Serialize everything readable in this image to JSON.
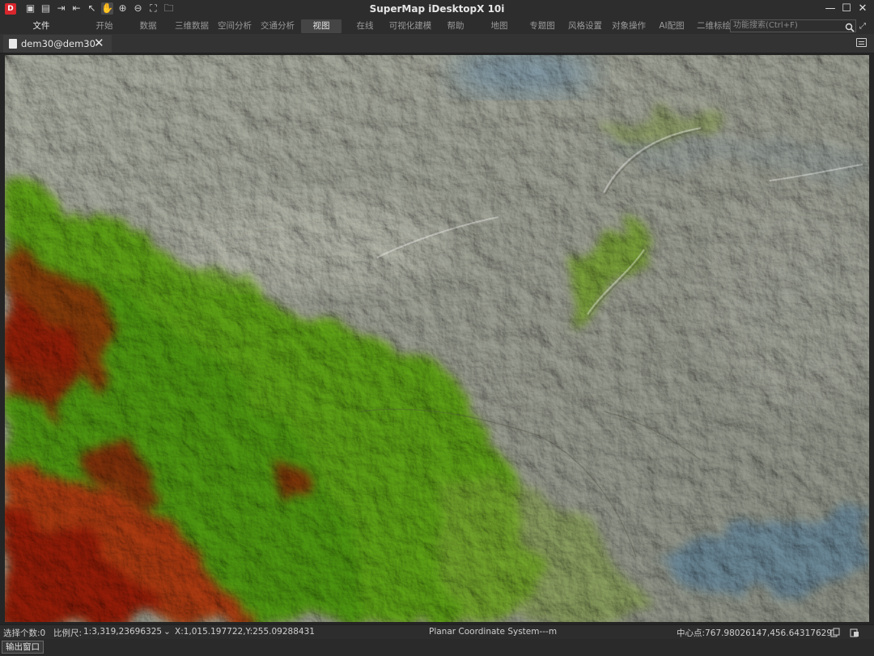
{
  "window": {
    "title": "SuperMap iDesktopX 10i",
    "minimize": "—",
    "maximize": "☐",
    "close": "✕"
  },
  "quick_access": {
    "logo": "D",
    "icons": [
      "save-icon",
      "save-as-icon",
      "import-icon",
      "export-icon",
      "select-pointer-icon",
      "pan-hand-icon",
      "zoom-in-icon",
      "zoom-out-icon",
      "full-extent-icon",
      "open-folder-icon"
    ]
  },
  "ribbon": {
    "tabs": [
      "文件",
      "开始",
      "数据",
      "三维数据",
      "空间分析",
      "交通分析",
      "视图",
      "在线",
      "可视化建模",
      "帮助",
      "地图",
      "专题图",
      "风格设置",
      "对象操作",
      "AI配图",
      "二维标绘"
    ],
    "active_tab": "视图",
    "search_placeholder": "功能搜索(Ctrl+F)"
  },
  "document_tab": {
    "label": "dem30@dem30",
    "close": "✕"
  },
  "map": {
    "dataset": "dem30",
    "type": "DEM hillshade"
  },
  "status": {
    "selection_count": "选择个数:0",
    "scale_label": "比例尺:",
    "scale_value": "1:3,319,23696325",
    "cursor_coords": "X:1,015.197722,Y:255.09288431",
    "coordinate_system": "Planar Coordinate System---m",
    "center_point": "中心点:767.98026147,456.64317629"
  },
  "bottom": {
    "output_tab": "输出窗口"
  },
  "colors": {
    "chrome_bg": "#2d2d2d",
    "lowland": "#c9ccc4",
    "midland_green": "#8ec63f",
    "highland_red": "#c4542a",
    "water": "#a7bcc6"
  }
}
